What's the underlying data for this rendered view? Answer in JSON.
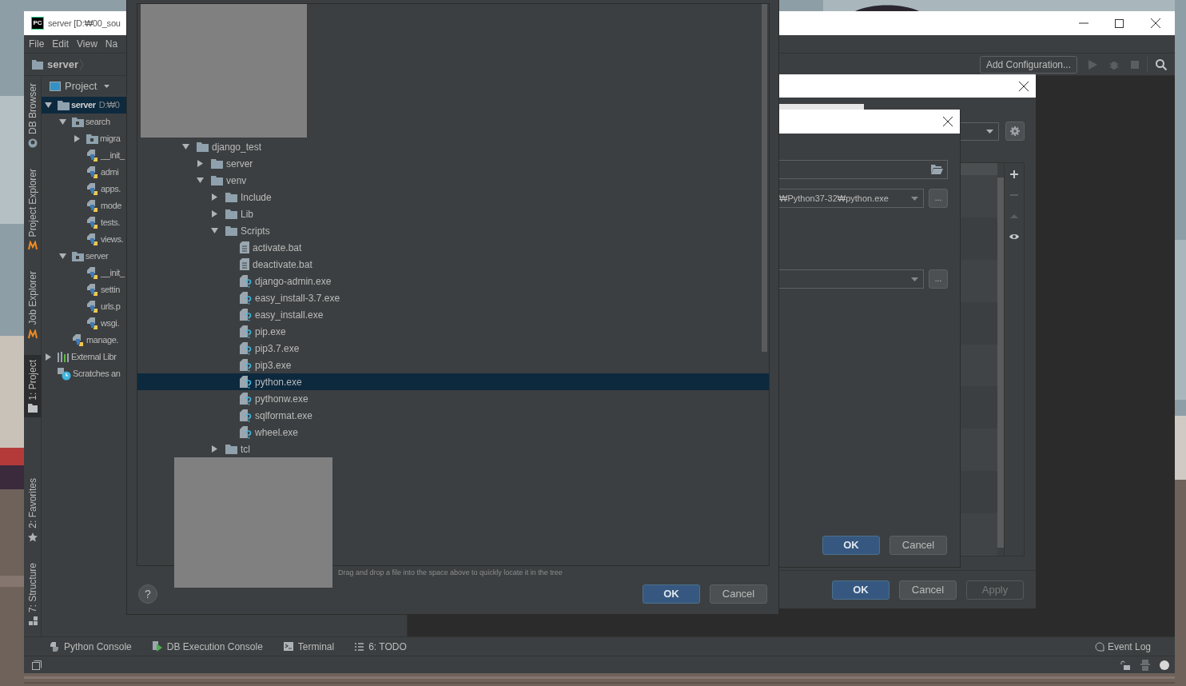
{
  "ide": {
    "logo": "PC",
    "title": "server [D:₩00_sou",
    "menu": [
      "File",
      "Edit",
      "View",
      "Na"
    ],
    "breadcrumb": "server",
    "run_config": "Add Configuration...",
    "tool_stripe_top": [
      {
        "label": "DB Browser",
        "kind": "db",
        "selected": false
      },
      {
        "label": "Project Explorer",
        "kind": "explorer",
        "selected": false
      },
      {
        "label": "Job Explorer",
        "kind": "explorer",
        "selected": false
      },
      {
        "label": "1: Project",
        "kind": "folder",
        "selected": true
      }
    ],
    "tool_stripe_bottom": [
      {
        "label": "2: Favorites",
        "kind": "star",
        "selected": false
      },
      {
        "label": "7: Structure",
        "kind": "structure",
        "selected": false
      }
    ],
    "project_panel": {
      "title": "Project",
      "tree": [
        {
          "name": "server",
          "hint": "D:₩0",
          "kind": "module",
          "expanded": true,
          "selected": true,
          "children": [
            {
              "name": "search",
              "kind": "package",
              "expanded": true,
              "selected": false,
              "children": [
                {
                  "name": "migra",
                  "kind": "package",
                  "expanded": false,
                  "selected": false
                },
                {
                  "name": "__init_",
                  "kind": "python",
                  "selected": false
                },
                {
                  "name": "admi",
                  "kind": "python",
                  "selected": false
                },
                {
                  "name": "apps.",
                  "kind": "python",
                  "selected": false
                },
                {
                  "name": "mode",
                  "kind": "python",
                  "selected": false
                },
                {
                  "name": "tests.",
                  "kind": "python",
                  "selected": false
                },
                {
                  "name": "views.",
                  "kind": "python",
                  "selected": false
                }
              ]
            },
            {
              "name": "server",
              "kind": "package",
              "expanded": true,
              "selected": false,
              "children": [
                {
                  "name": "__init_",
                  "kind": "python",
                  "selected": false
                },
                {
                  "name": "settin",
                  "kind": "python",
                  "selected": false
                },
                {
                  "name": "urls.p",
                  "kind": "python",
                  "selected": false
                },
                {
                  "name": "wsgi.",
                  "kind": "python",
                  "selected": false
                }
              ]
            },
            {
              "name": "manage.",
              "kind": "python",
              "selected": false
            }
          ]
        },
        {
          "name": "External Libr",
          "kind": "library",
          "expanded": false,
          "selected": false
        },
        {
          "name": "Scratches an",
          "kind": "scratches",
          "selected": false
        }
      ]
    },
    "bottom_tabs": [
      {
        "label": "Python Console",
        "kind": "python"
      },
      {
        "label": "DB Execution Console",
        "kind": "db"
      },
      {
        "label": "Terminal",
        "kind": "terminal"
      },
      {
        "label": "6: TODO",
        "kind": "todo"
      }
    ],
    "event_log": "Event Log"
  },
  "file_chooser": {
    "tree": [
      {
        "name": "django_test",
        "kind": "folder",
        "expanded": true,
        "selected": false,
        "children": [
          {
            "name": "server",
            "kind": "folder",
            "expanded": false,
            "selected": false
          },
          {
            "name": "venv",
            "kind": "folder",
            "expanded": true,
            "selected": false,
            "children": [
              {
                "name": "Include",
                "kind": "folder",
                "expanded": false,
                "selected": false
              },
              {
                "name": "Lib",
                "kind": "folder",
                "expanded": false,
                "selected": false
              },
              {
                "name": "Scripts",
                "kind": "folder",
                "expanded": true,
                "selected": false,
                "children": [
                  {
                    "name": "activate.bat",
                    "kind": "text",
                    "selected": false
                  },
                  {
                    "name": "deactivate.bat",
                    "kind": "text",
                    "selected": false
                  },
                  {
                    "name": "django-admin.exe",
                    "kind": "exe",
                    "selected": false
                  },
                  {
                    "name": "easy_install-3.7.exe",
                    "kind": "exe",
                    "selected": false
                  },
                  {
                    "name": "easy_install.exe",
                    "kind": "exe",
                    "selected": false
                  },
                  {
                    "name": "pip.exe",
                    "kind": "exe",
                    "selected": false
                  },
                  {
                    "name": "pip3.7.exe",
                    "kind": "exe",
                    "selected": false
                  },
                  {
                    "name": "pip3.exe",
                    "kind": "exe",
                    "selected": false
                  },
                  {
                    "name": "python.exe",
                    "kind": "exe",
                    "selected": true
                  },
                  {
                    "name": "pythonw.exe",
                    "kind": "exe",
                    "selected": false
                  },
                  {
                    "name": "sqlformat.exe",
                    "kind": "exe",
                    "selected": false
                  },
                  {
                    "name": "wheel.exe",
                    "kind": "exe",
                    "selected": false
                  }
                ]
              },
              {
                "name": "tcl",
                "kind": "folder",
                "expanded": false,
                "selected": false
              }
            ]
          }
        ]
      }
    ],
    "hint": "Drag and drop a file into the space above to quickly locate it in the tree",
    "help": "?",
    "buttons": [
      {
        "label": "OK",
        "default": true
      },
      {
        "label": "Cancel",
        "default": false
      }
    ]
  },
  "settings_dialog": {
    "side_tools": [
      {
        "kind": "add",
        "disabled": false
      },
      {
        "kind": "remove",
        "disabled": true
      },
      {
        "kind": "up",
        "disabled": true
      },
      {
        "kind": "show",
        "disabled": false
      }
    ],
    "buttons": [
      {
        "label": "OK",
        "default": true,
        "disabled": false
      },
      {
        "label": "Cancel",
        "default": false,
        "disabled": false
      },
      {
        "label": "Apply",
        "disabled": true
      }
    ]
  },
  "interpreter_dialog": {
    "fields": [
      {
        "kind": "path"
      },
      {
        "kind": "combo",
        "value": "₩Python37-32₩python.exe",
        "button": "..."
      },
      {
        "kind": "combo",
        "button": "..."
      }
    ],
    "buttons": [
      {
        "label": "OK",
        "default": true
      },
      {
        "label": "Cancel",
        "default": false
      }
    ]
  }
}
